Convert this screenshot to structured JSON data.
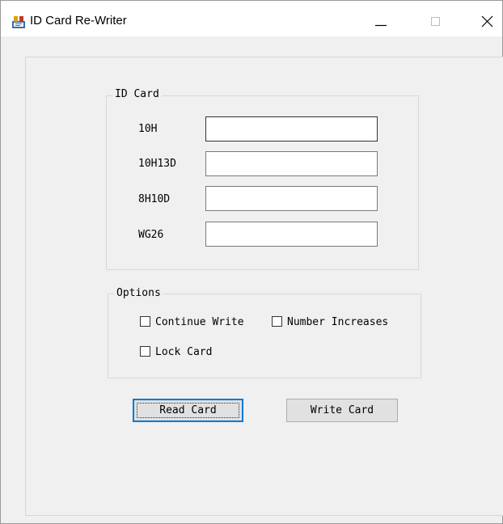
{
  "window": {
    "title": "ID Card Re-Writer"
  },
  "id_card": {
    "legend": "ID Card",
    "fields": [
      {
        "label": "10H",
        "value": ""
      },
      {
        "label": "10H13D",
        "value": ""
      },
      {
        "label": "8H10D",
        "value": ""
      },
      {
        "label": "WG26",
        "value": ""
      }
    ]
  },
  "options": {
    "legend": "Options",
    "continue_write": {
      "label": "Continue Write",
      "checked": false
    },
    "number_increases": {
      "label": "Number Increases",
      "checked": false
    },
    "lock_card": {
      "label": "Lock Card",
      "checked": false
    }
  },
  "buttons": {
    "read_card": "Read Card",
    "write_card": "Write Card"
  }
}
